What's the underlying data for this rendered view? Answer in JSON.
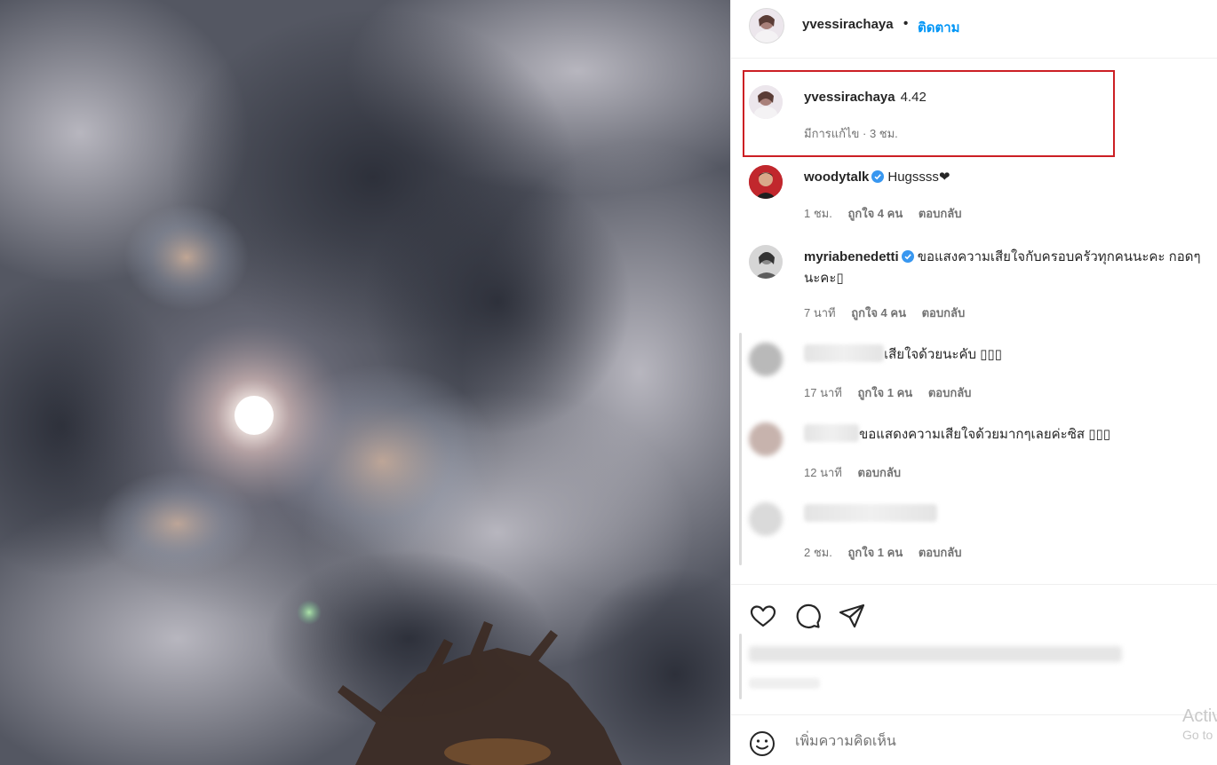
{
  "post": {
    "author": "yvessirachaya",
    "separator": "•",
    "follow_label": "ติดตาม"
  },
  "caption": {
    "username": "yvessirachaya",
    "text": "4.42",
    "meta_edited": "มีการแก้ไข · 3 ชม."
  },
  "comments": [
    {
      "username": "woodytalk",
      "verified": true,
      "text": "Hugssss❤",
      "time": "1 ชม.",
      "likes": "ถูกใจ 4 คน",
      "reply": "ตอบกลับ"
    },
    {
      "username": "myriabenedetti",
      "verified": true,
      "text": "ขอแสงความเสียใจกับครอบครัวทุกคนนะคะ กอดๆนะคะ▯",
      "time": "7 นาที",
      "likes": "ถูกใจ 4 คน",
      "reply": "ตอบกลับ"
    },
    {
      "username": "",
      "verified": false,
      "text": "เสียใจด้วยนะคับ ▯▯▯",
      "time": "17 นาที",
      "likes": "ถูกใจ 1 คน",
      "reply": "ตอบกลับ"
    },
    {
      "username": "",
      "verified": false,
      "text": "ขอแสดงความเสียใจด้วยมากๆเลยค่ะซิส ▯▯▯",
      "time": "12 นาที",
      "likes": "",
      "reply": "ตอบกลับ"
    },
    {
      "username": "",
      "verified": false,
      "text": "",
      "time": "2 ชม.",
      "likes": "ถูกใจ 1 คน",
      "reply": "ตอบกลับ"
    }
  ],
  "actions": {
    "like_icon": "heart-icon",
    "comment_icon": "speech-bubble-icon",
    "share_icon": "paper-plane-icon"
  },
  "composer": {
    "emoji_icon": "smiley-icon",
    "placeholder": "เพิ่มความคิดเห็น"
  },
  "watermark": {
    "line1": "Activ",
    "line2": "Go to"
  },
  "colors": {
    "follow": "#0095f6",
    "highlight_box": "#cc1f24",
    "verified": "#3897f0",
    "secondary_text": "#737373"
  }
}
